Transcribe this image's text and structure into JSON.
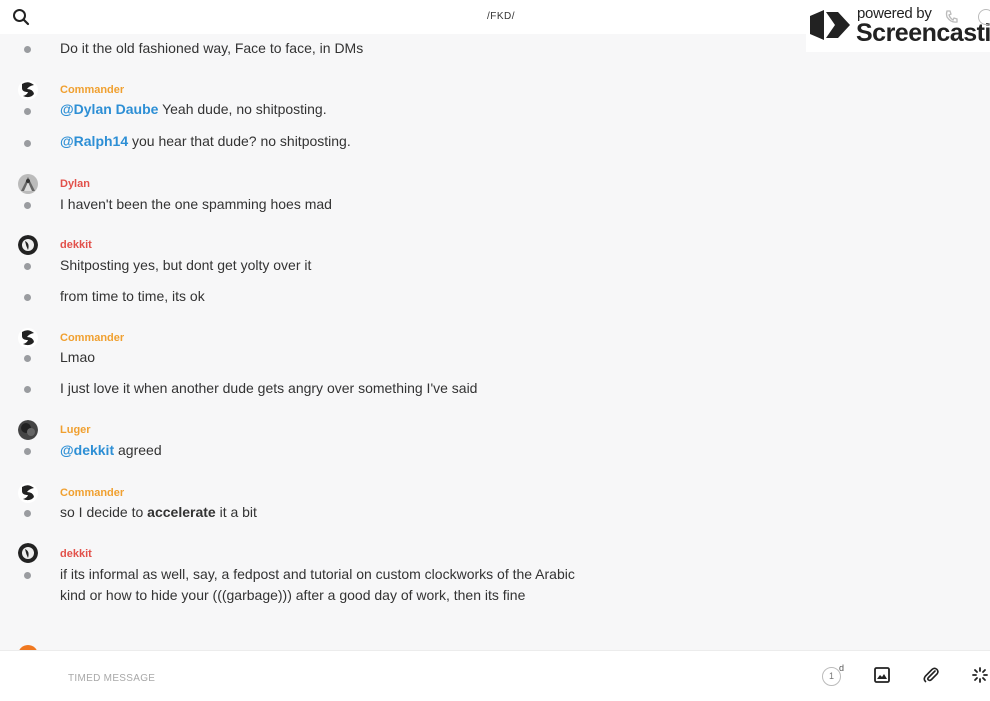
{
  "header": {
    "channel_title": "/FKD/",
    "search_icon": "search-icon"
  },
  "watermark": {
    "powered_by": "powered by",
    "brand": "Screencastify"
  },
  "messages": [
    {
      "text": "Do it the old fashioned way, Face to face, in DMs"
    },
    {
      "author": "Commander",
      "author_color": "#f0a030",
      "mention": "@Dylan Daube",
      "text": " Yeah dude, no shitposting."
    },
    {
      "mention": "@Ralph14",
      "text": " you hear that dude? no shitposting."
    },
    {
      "author": "Dylan",
      "author_color": "#e2504a",
      "text": "I haven't been the one spamming hoes mad"
    },
    {
      "author": "dekkit",
      "author_color": "#e2504a",
      "text": "Shitposting yes, but dont get yolty over it"
    },
    {
      "text": "from time to time, its ok"
    },
    {
      "author": "Commander",
      "author_color": "#f0a030",
      "text": "Lmao"
    },
    {
      "text": "I just love it when another dude gets angry over something I've said"
    },
    {
      "author": "Luger",
      "author_color": "#f0a030",
      "mention": "@dekkit",
      "text": " agreed"
    },
    {
      "author": "Commander",
      "author_color": "#f0a030",
      "text_before": "so I decide to ",
      "bold": "accelerate",
      "text_after": " it a bit"
    },
    {
      "author": "dekkit",
      "author_color": "#e2504a",
      "text": "if its informal as well, say, a fedpost and tutorial on custom clockworks of the Arabic kind or how to hide your (((garbage))) after a good day of work, then its fine"
    }
  ],
  "composer": {
    "placeholder": "TIMED MESSAGE",
    "timer_value": "1",
    "timer_unit": "d",
    "icons": [
      "timer-icon",
      "image-icon",
      "paperclip-icon",
      "loading-spinner-icon"
    ]
  },
  "colors": {
    "mention": "#2d8fd5",
    "author_orange": "#f0a030",
    "author_red": "#e2504a",
    "background": "#f7f7f8"
  }
}
